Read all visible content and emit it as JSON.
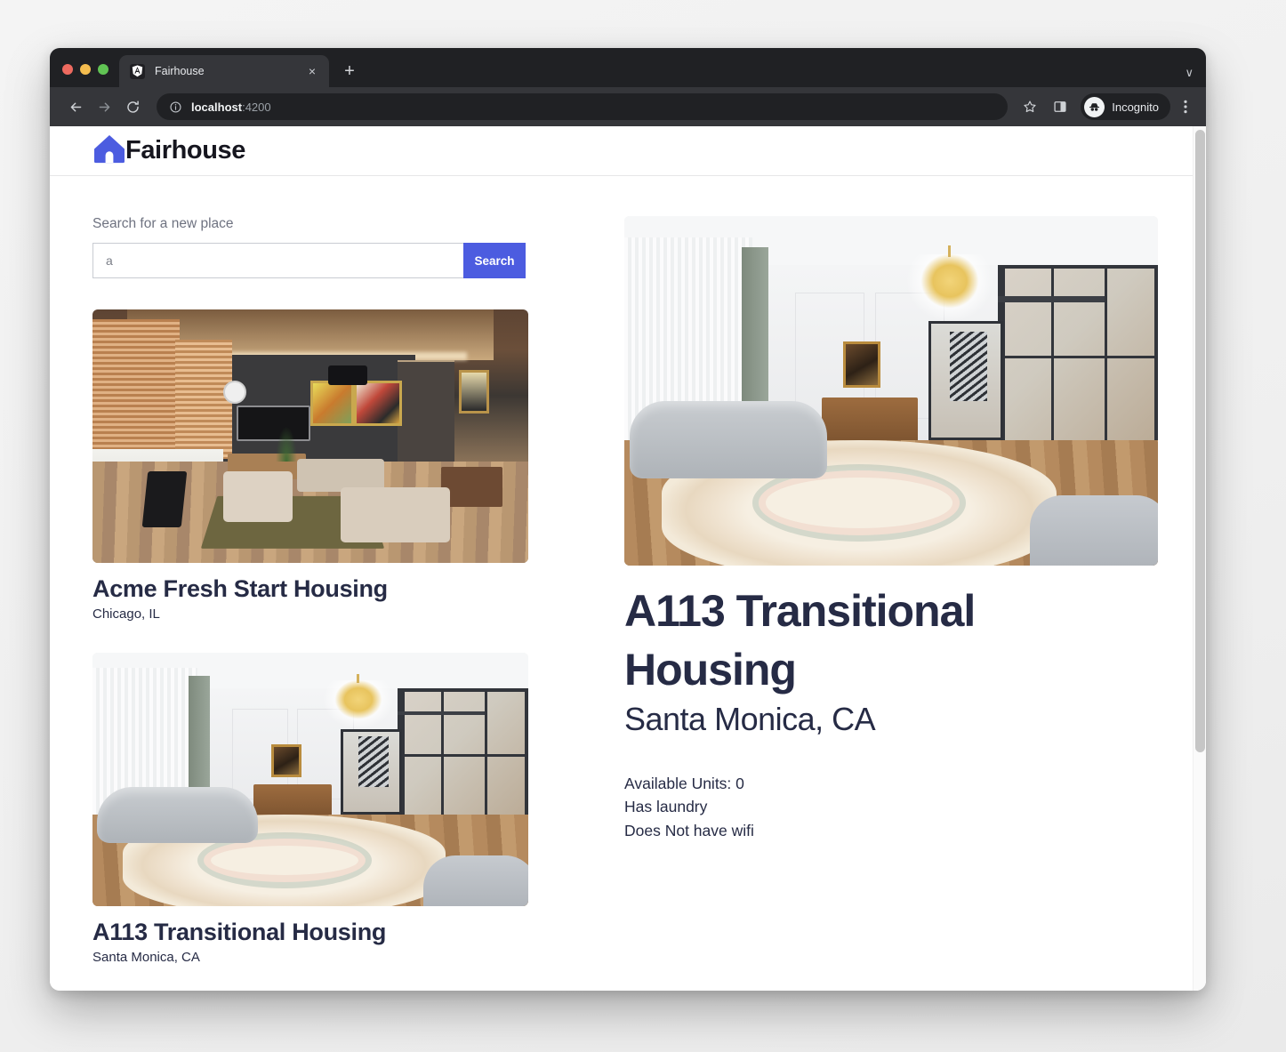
{
  "browser": {
    "tab": {
      "title": "Fairhouse",
      "favicon": "angular-shield-icon",
      "close_label": "×"
    },
    "new_tab_label": "+",
    "tab_list_chevron": "∨",
    "toolbar": {
      "back_icon": "back-arrow-icon",
      "forward_icon": "forward-arrow-icon",
      "reload_icon": "reload-icon",
      "site_info_icon": "info-circle-icon",
      "url_host": "localhost",
      "url_port": ":4200",
      "bookmark_icon": "star-icon",
      "side_panel_icon": "side-panel-icon",
      "profile_label": "Incognito",
      "profile_icon": "incognito-hat-icon",
      "menu_icon": "kebab-menu-icon"
    }
  },
  "app": {
    "brand": {
      "name": "Fairhouse",
      "logo": "house-icon",
      "logo_color": "#4c5ce0"
    },
    "search": {
      "label": "Search for a new place",
      "value": "a",
      "button_label": "Search",
      "button_color": "#4c5ce0"
    },
    "listings": [
      {
        "name": "Acme Fresh Start Housing",
        "city": "Chicago, IL",
        "photo": "dark-modern-living-room-photo"
      },
      {
        "name": "A113 Transitional Housing",
        "city": "Santa Monica, CA",
        "photo": "bright-classic-living-room-photo"
      }
    ],
    "detail": {
      "name": "A113 Transitional Housing",
      "city": "Santa Monica, CA",
      "photo": "bright-classic-living-room-photo",
      "facts": [
        "Available Units: 0",
        "Has laundry",
        "Does Not have wifi"
      ]
    },
    "text_color": "#262b45"
  }
}
